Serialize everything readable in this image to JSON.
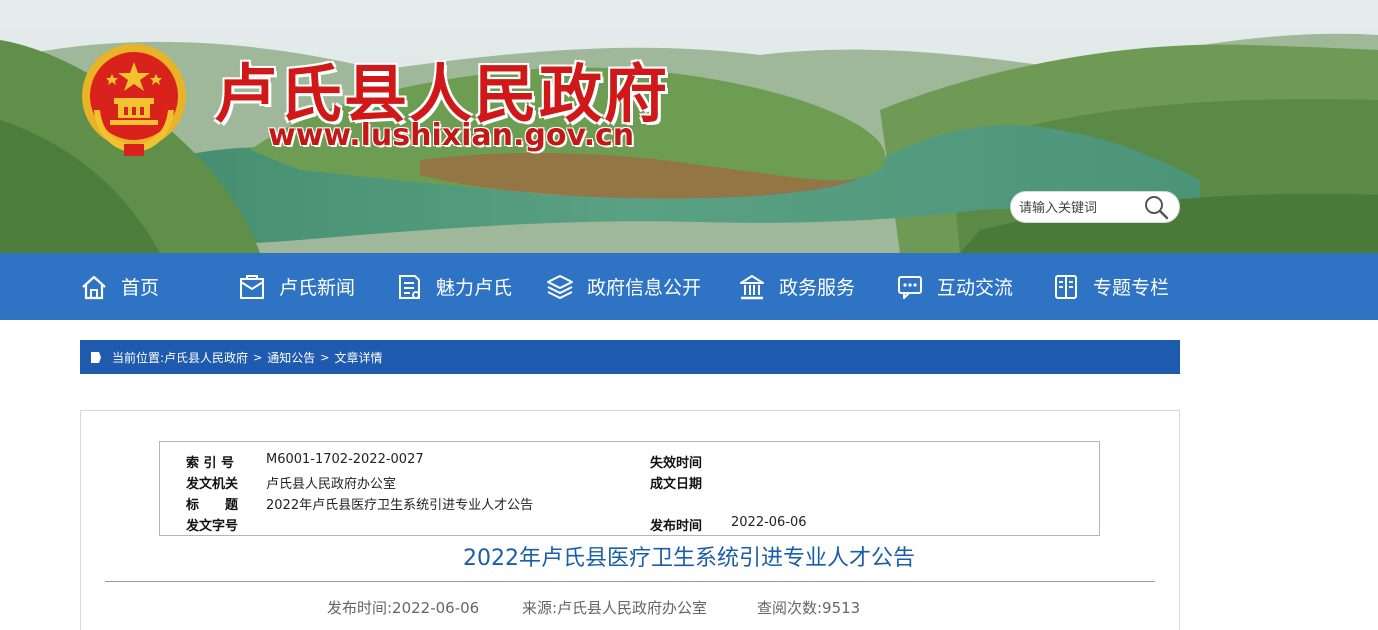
{
  "header": {
    "site_name": "卢氏县人民政府",
    "site_url": "www.lushixian.gov.cn",
    "search": {
      "placeholder": "请输入关键词"
    },
    "icons": {
      "emblem": "national-emblem",
      "search": "search-icon"
    }
  },
  "nav": {
    "items": [
      {
        "label": "首页",
        "icon": "home-icon"
      },
      {
        "label": "卢氏新闻",
        "icon": "news-icon"
      },
      {
        "label": "魅力卢氏",
        "icon": "document-icon"
      },
      {
        "label": "政府信息公开",
        "icon": "layers-icon"
      },
      {
        "label": "政务服务",
        "icon": "building-icon"
      },
      {
        "label": "互动交流",
        "icon": "chat-icon"
      },
      {
        "label": "专题专栏",
        "icon": "book-icon"
      }
    ]
  },
  "breadcrumb": {
    "prefix": "当前位置:",
    "items": [
      "卢氏县人民政府",
      "通知公告",
      "文章详情"
    ],
    "separator": ">"
  },
  "meta": {
    "index_label": "索 引 号",
    "index_value": "M6001-1702-2022-0027",
    "expire_label": "失效时间",
    "expire_value": "",
    "issuer_label": "发文机关",
    "issuer_value": "卢氏县人民政府办公室",
    "created_label": "成文日期",
    "created_value": "",
    "title_label": "标　　题",
    "title_value": "2022年卢氏县医疗卫生系统引进专业人才公告",
    "docno_label": "发文字号",
    "docno_value": "",
    "published_label": "发布时间",
    "published_value": "2022-06-06"
  },
  "article": {
    "title": "2022年卢氏县医疗卫生系统引进专业人才公告",
    "publish_time": "发布时间:2022-06-06",
    "source": "来源:卢氏县人民政府办公室",
    "views": "查阅次数:9513"
  },
  "colors": {
    "nav_bg": "#2f74c4",
    "breadcrumb_bg": "#1e5aad",
    "site_name": "#d01818",
    "article_title": "#1a5ea8"
  }
}
